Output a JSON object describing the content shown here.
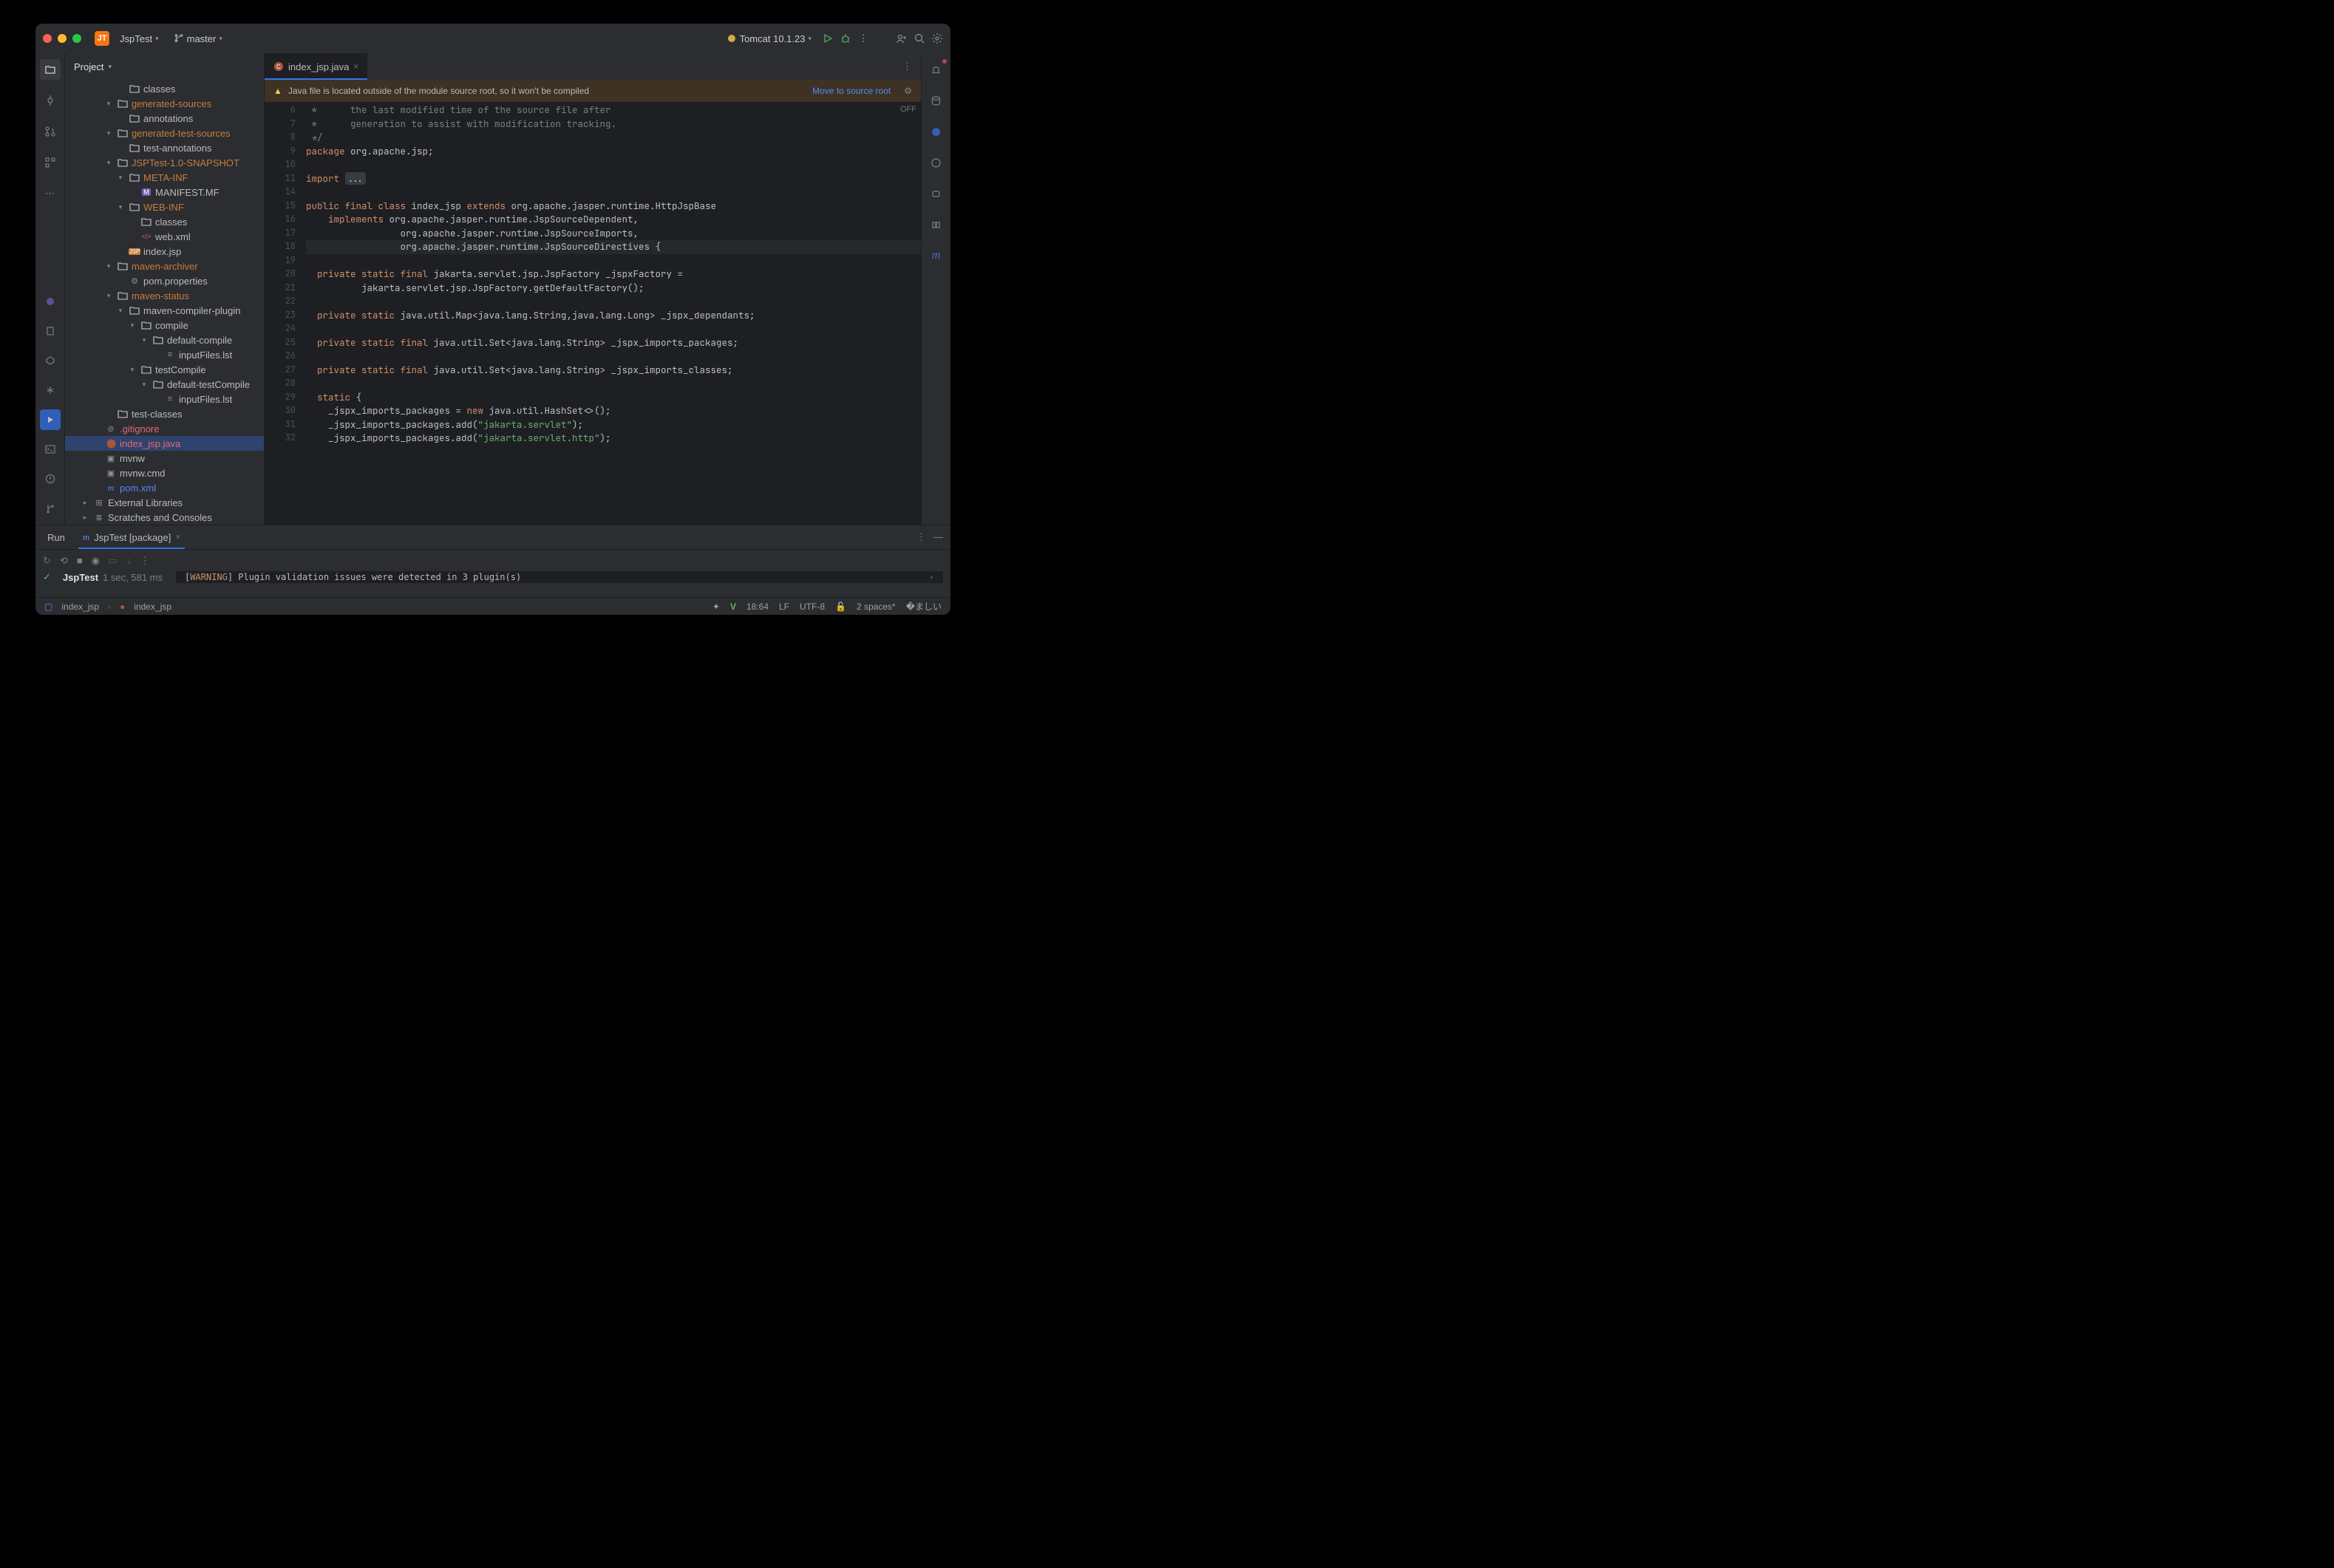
{
  "titlebar": {
    "project_badge": "JT",
    "project_name": "JspTest",
    "vcs_branch": "master",
    "run_config": "Tomcat 10.1.23"
  },
  "project_panel": {
    "title": "Project"
  },
  "tree": [
    {
      "indent": 3,
      "icon": "folder",
      "name": "classes",
      "twisty": ""
    },
    {
      "indent": 2,
      "icon": "folder",
      "name": "generated-sources",
      "twisty": "v",
      "orange": true
    },
    {
      "indent": 3,
      "icon": "folder",
      "name": "annotations",
      "twisty": ""
    },
    {
      "indent": 2,
      "icon": "folder",
      "name": "generated-test-sources",
      "twisty": "v",
      "orange": true
    },
    {
      "indent": 3,
      "icon": "folder",
      "name": "test-annotations",
      "twisty": ""
    },
    {
      "indent": 2,
      "icon": "folder",
      "name": "JSPTest-1.0-SNAPSHOT",
      "twisty": "v",
      "orange": true
    },
    {
      "indent": 3,
      "icon": "folder",
      "name": "META-INF",
      "twisty": "v",
      "orange": true
    },
    {
      "indent": 4,
      "icon": "manifest",
      "name": "MANIFEST.MF",
      "twisty": ""
    },
    {
      "indent": 3,
      "icon": "folder",
      "name": "WEB-INF",
      "twisty": "v",
      "orange": true
    },
    {
      "indent": 4,
      "icon": "folder",
      "name": "classes",
      "twisty": ""
    },
    {
      "indent": 4,
      "icon": "xml",
      "name": "web.xml",
      "twisty": ""
    },
    {
      "indent": 3,
      "icon": "jsp",
      "name": "index.jsp",
      "twisty": ""
    },
    {
      "indent": 2,
      "icon": "folder",
      "name": "maven-archiver",
      "twisty": "v",
      "orange": true
    },
    {
      "indent": 3,
      "icon": "gear",
      "name": "pom.properties",
      "twisty": ""
    },
    {
      "indent": 2,
      "icon": "folder",
      "name": "maven-status",
      "twisty": "v",
      "orange": true
    },
    {
      "indent": 3,
      "icon": "folder",
      "name": "maven-compiler-plugin",
      "twisty": "v"
    },
    {
      "indent": 4,
      "icon": "folder",
      "name": "compile",
      "twisty": "v"
    },
    {
      "indent": 5,
      "icon": "folder",
      "name": "default-compile",
      "twisty": "v"
    },
    {
      "indent": 6,
      "icon": "file",
      "name": "inputFiles.lst",
      "twisty": ""
    },
    {
      "indent": 4,
      "icon": "folder",
      "name": "testCompile",
      "twisty": "v"
    },
    {
      "indent": 5,
      "icon": "folder",
      "name": "default-testCompile",
      "twisty": "v"
    },
    {
      "indent": 6,
      "icon": "file",
      "name": "inputFiles.lst",
      "twisty": ""
    },
    {
      "indent": 2,
      "icon": "folder",
      "name": "test-classes",
      "twisty": ""
    },
    {
      "indent": 1,
      "icon": "ignore",
      "name": ".gitignore",
      "twisty": "",
      "red": true
    },
    {
      "indent": 1,
      "icon": "java",
      "name": "index_jsp.java",
      "twisty": "",
      "red": true,
      "selected": true
    },
    {
      "indent": 1,
      "icon": "sh",
      "name": "mvnw",
      "twisty": ""
    },
    {
      "indent": 1,
      "icon": "bat",
      "name": "mvnw.cmd",
      "twisty": ""
    },
    {
      "indent": 1,
      "icon": "maven",
      "name": "pom.xml",
      "twisty": "",
      "blue": true
    },
    {
      "indent": 0,
      "icon": "lib",
      "name": "External Libraries",
      "twisty": ">"
    },
    {
      "indent": 0,
      "icon": "scratch",
      "name": "Scratches and Consoles",
      "twisty": ">"
    }
  ],
  "editor": {
    "tab_name": "index_jsp.java",
    "banner_text": "Java file is located outside of the module source root, so it won't be compiled",
    "banner_action": "Move to source root",
    "off": "OFF",
    "lines": [
      {
        "n": 6,
        "segs": [
          {
            "t": " *      the last modified time of the source file after",
            "cls": "com"
          }
        ]
      },
      {
        "n": 7,
        "segs": [
          {
            "t": " *      generation to assist with modification tracking.",
            "cls": "com"
          }
        ]
      },
      {
        "n": 8,
        "segs": [
          {
            "t": " */",
            "cls": "com"
          }
        ]
      },
      {
        "n": 9,
        "segs": [
          {
            "t": "package ",
            "cls": "kw"
          },
          {
            "t": "org.apache.jsp;"
          }
        ]
      },
      {
        "n": 10,
        "segs": []
      },
      {
        "n": 11,
        "segs": [
          {
            "t": "import ",
            "cls": "kw"
          },
          {
            "t": "...",
            "cls": "fold"
          }
        ]
      },
      {
        "n": 14,
        "segs": []
      },
      {
        "n": 15,
        "segs": [
          {
            "t": "public final class ",
            "cls": "kw"
          },
          {
            "t": "index_jsp "
          },
          {
            "t": "extends ",
            "cls": "kw"
          },
          {
            "t": "org.apache.jasper.runtime.HttpJspBase"
          }
        ]
      },
      {
        "n": 16,
        "segs": [
          {
            "t": "    "
          },
          {
            "t": "implements ",
            "cls": "kw"
          },
          {
            "t": "org.apache.jasper.runtime.JspSourceDependent,"
          }
        ]
      },
      {
        "n": 17,
        "segs": [
          {
            "t": "                 org.apache.jasper.runtime.JspSourceImports,"
          }
        ]
      },
      {
        "n": 18,
        "hl": true,
        "segs": [
          {
            "t": "                 org.apache.jasper.runtime.JspSourceDirectives {"
          }
        ]
      },
      {
        "n": 19,
        "segs": []
      },
      {
        "n": 20,
        "segs": [
          {
            "t": "  "
          },
          {
            "t": "private static final ",
            "cls": "kw"
          },
          {
            "t": "jakarta.servlet.jsp.JspFactory _jspxFactory ="
          }
        ]
      },
      {
        "n": 21,
        "segs": [
          {
            "t": "          jakarta.servlet.jsp.JspFactory.getDefaultFactory();"
          }
        ]
      },
      {
        "n": 22,
        "segs": []
      },
      {
        "n": 23,
        "segs": [
          {
            "t": "  "
          },
          {
            "t": "private static ",
            "cls": "kw"
          },
          {
            "t": "java.util.Map<java.lang.String,java.lang.Long> _jspx_dependants;"
          }
        ]
      },
      {
        "n": 24,
        "segs": []
      },
      {
        "n": 25,
        "segs": [
          {
            "t": "  "
          },
          {
            "t": "private static final ",
            "cls": "kw"
          },
          {
            "t": "java.util.Set<java.lang.String> _jspx_imports_packages;"
          }
        ]
      },
      {
        "n": 26,
        "segs": []
      },
      {
        "n": 27,
        "segs": [
          {
            "t": "  "
          },
          {
            "t": "private static final ",
            "cls": "kw"
          },
          {
            "t": "java.util.Set<java.lang.String> _jspx_imports_classes;"
          }
        ]
      },
      {
        "n": 28,
        "segs": []
      },
      {
        "n": 29,
        "segs": [
          {
            "t": "  "
          },
          {
            "t": "static ",
            "cls": "kw"
          },
          {
            "t": "{"
          }
        ]
      },
      {
        "n": 30,
        "segs": [
          {
            "t": "    _jspx_imports_packages = "
          },
          {
            "t": "new ",
            "cls": "kw"
          },
          {
            "t": "java.util.HashSet<>();"
          }
        ]
      },
      {
        "n": 31,
        "segs": [
          {
            "t": "    _jspx_imports_packages.add("
          },
          {
            "t": "\"jakarta.servlet\"",
            "cls": "str"
          },
          {
            "t": ");"
          }
        ]
      },
      {
        "n": 32,
        "segs": [
          {
            "t": "    _jspx_imports_packages.add("
          },
          {
            "t": "\"jakarta.servlet.http\"",
            "cls": "str"
          },
          {
            "t": ");"
          }
        ]
      }
    ]
  },
  "run_panel": {
    "run_label": "Run",
    "config_name": "JspTest [package]",
    "result_name": "JspTest",
    "result_time": "1 sec, 581 ms",
    "log_warning": "WARNING",
    "log_text": "] Plugin validation issues were detected in 3 plugin(s)"
  },
  "breadcrumb": {
    "file": "index_jsp",
    "class": "index_jsp"
  },
  "status": {
    "pos": "18:64",
    "eol": "LF",
    "encoding": "UTF-8",
    "indent": "2 spaces*"
  }
}
